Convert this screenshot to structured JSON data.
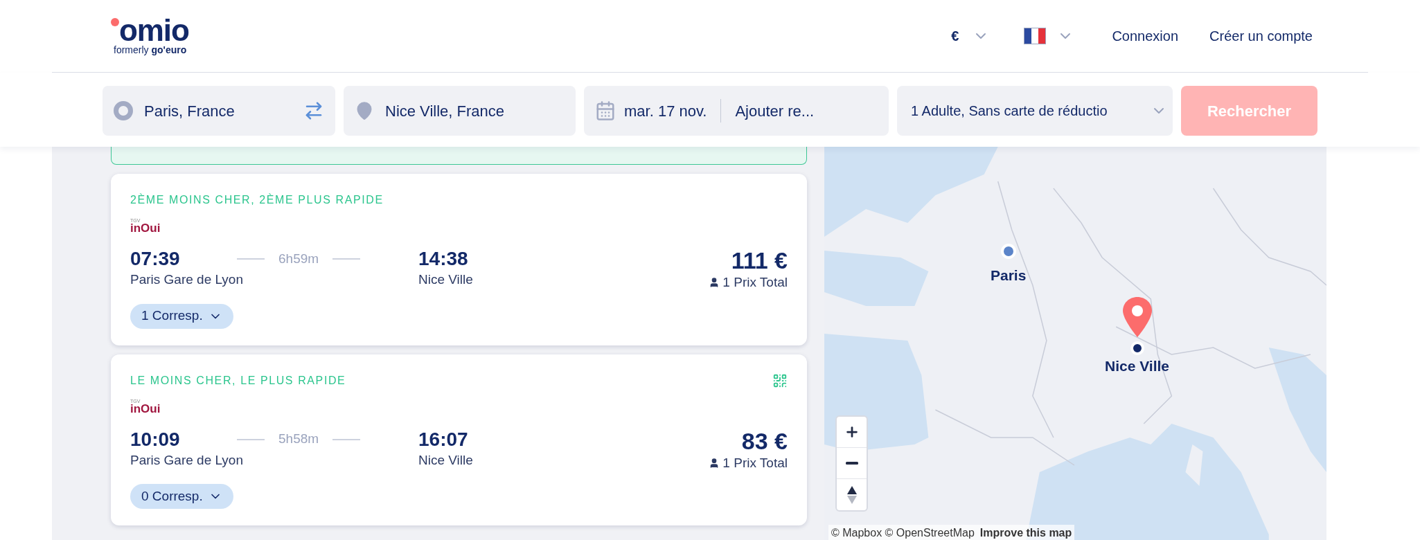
{
  "header": {
    "logo": "omio",
    "tagline": "formerly **go'euro**",
    "currency": "€",
    "links": [
      "Connexion",
      "Créer un compte"
    ]
  },
  "search": {
    "from": "Paris, France",
    "to": "Nice Ville, France",
    "date": "mar. 17 nov.",
    "return_date": "Ajouter re...",
    "passengers": "1 Adulte, Sans carte de réductio",
    "button": {
      "label": "Rechercher",
      "disabled": true
    }
  },
  "results": [
    {
      "tag": "2ÈME MOINS CHER, 2ÈME PLUS RAPIDE",
      "operator_small": "TGV",
      "operator": "inOui",
      "depart": "07:39",
      "duration": "6h59m",
      "arrive": "14:38",
      "from": "Paris Gare de Lyon",
      "to": "Nice Ville",
      "price": "111 €",
      "price_note": "1 Prix Total",
      "transfers": "1 Corresp.",
      "mobile_ticket": false
    },
    {
      "tag": "LE MOINS CHER, LE PLUS RAPIDE",
      "operator_small": "TGV",
      "operator": "inOui",
      "depart": "10:09",
      "duration": "5h58m",
      "arrive": "16:07",
      "from": "Paris Gare de Lyon",
      "to": "Nice Ville",
      "price": "83 €",
      "price_note": "1 Prix Total",
      "transfers": "0 Corresp.",
      "mobile_ticket": true
    }
  ],
  "map": {
    "kind": "picture",
    "markers": [
      {
        "kind": "origin",
        "label": "Paris"
      },
      {
        "kind": "destination",
        "label": "Nice Ville"
      }
    ],
    "attribution": [
      "© Mapbox © OpenStreetMap",
      "Improve this map"
    ]
  }
}
